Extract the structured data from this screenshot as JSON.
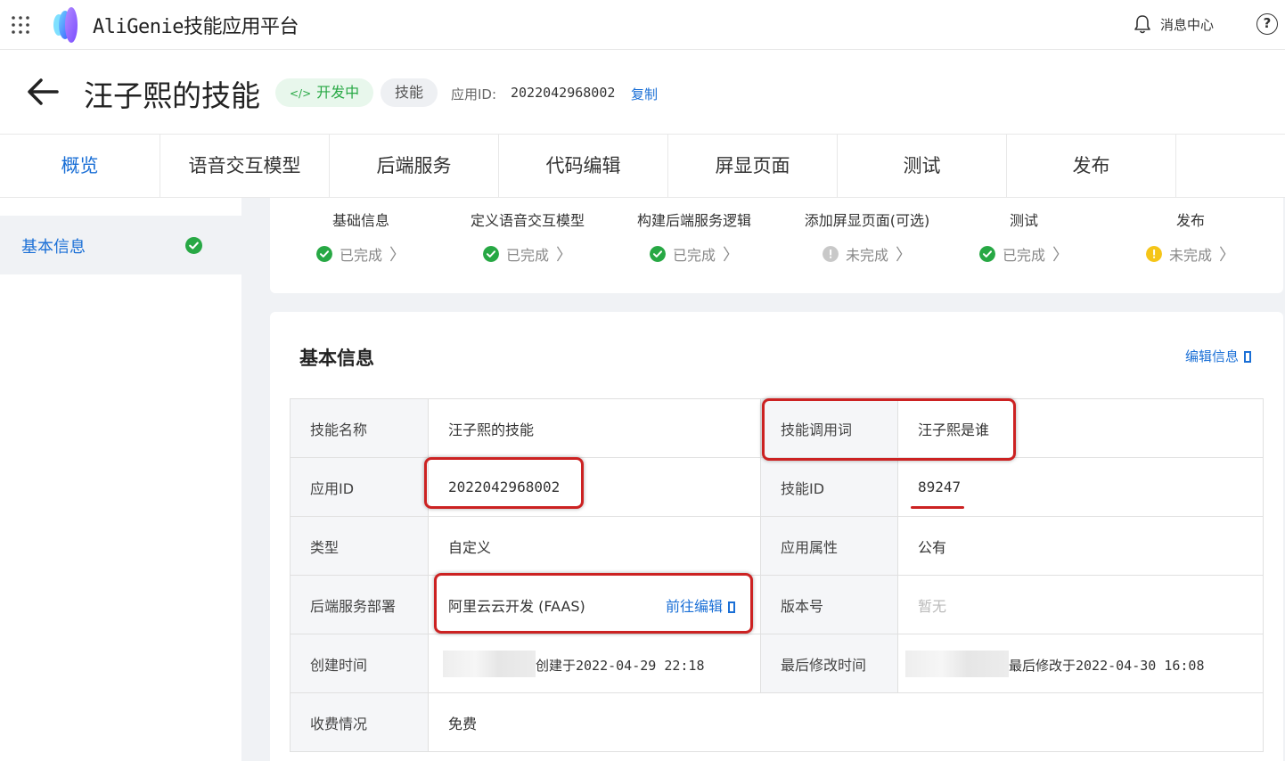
{
  "header": {
    "app_name_latin": "AliGenie",
    "app_name_cn": "技能应用平台",
    "messages_label": "消息中心",
    "help_label": "?"
  },
  "title_row": {
    "skill_name": "汪子熙的技能",
    "status_tag": "开发中",
    "type_tag": "技能",
    "app_id_label": "应用ID:",
    "app_id_value": "2022042968002",
    "copy_label": "复制"
  },
  "tabs": [
    {
      "label": "概览",
      "active": true
    },
    {
      "label": "语音交互模型"
    },
    {
      "label": "后端服务"
    },
    {
      "label": "代码编辑"
    },
    {
      "label": "屏显页面"
    },
    {
      "label": "测试"
    },
    {
      "label": "发布"
    }
  ],
  "sidebar": {
    "items": [
      {
        "label": "基本信息",
        "status": "done"
      }
    ]
  },
  "progress": {
    "steps": [
      {
        "title": "基础信息",
        "status": "已完成",
        "state": "done"
      },
      {
        "title": "定义语音交互模型",
        "status": "已完成",
        "state": "done"
      },
      {
        "title": "构建后端服务逻辑",
        "status": "已完成",
        "state": "done"
      },
      {
        "title": "添加屏显页面(可选)",
        "status": "未完成",
        "state": "optional"
      },
      {
        "title": "测试",
        "status": "已完成",
        "state": "done"
      },
      {
        "title": "发布",
        "status": "未完成",
        "state": "warning"
      }
    ]
  },
  "info": {
    "title": "基本信息",
    "edit_label": "编辑信息",
    "rows": [
      {
        "l1": "技能名称",
        "v1": "汪子熙的技能",
        "l2": "技能调用词",
        "v2": "汪子熙是谁"
      },
      {
        "l1": "应用ID",
        "v1": "2022042968002",
        "l2": "技能ID",
        "v2": "89247"
      },
      {
        "l1": "类型",
        "v1": "自定义",
        "l2": "应用属性",
        "v2": "公有"
      },
      {
        "l1": "后端服务部署",
        "v1": "阿里云云开发 (FAAS)",
        "v1_action": "前往编辑",
        "l2": "版本号",
        "v2": "暂无"
      },
      {
        "l1": "创建时间",
        "v1": "创建于2022-04-29 22:18",
        "l2": "最后修改时间",
        "v2": "最后修改于2022-04-30 16:08"
      },
      {
        "l1": "收费情况",
        "v1": "免费"
      }
    ]
  },
  "colors": {
    "accent": "#1a6fd6",
    "success": "#27a844",
    "warning": "#f5c518",
    "annotation": "#cc2222"
  }
}
